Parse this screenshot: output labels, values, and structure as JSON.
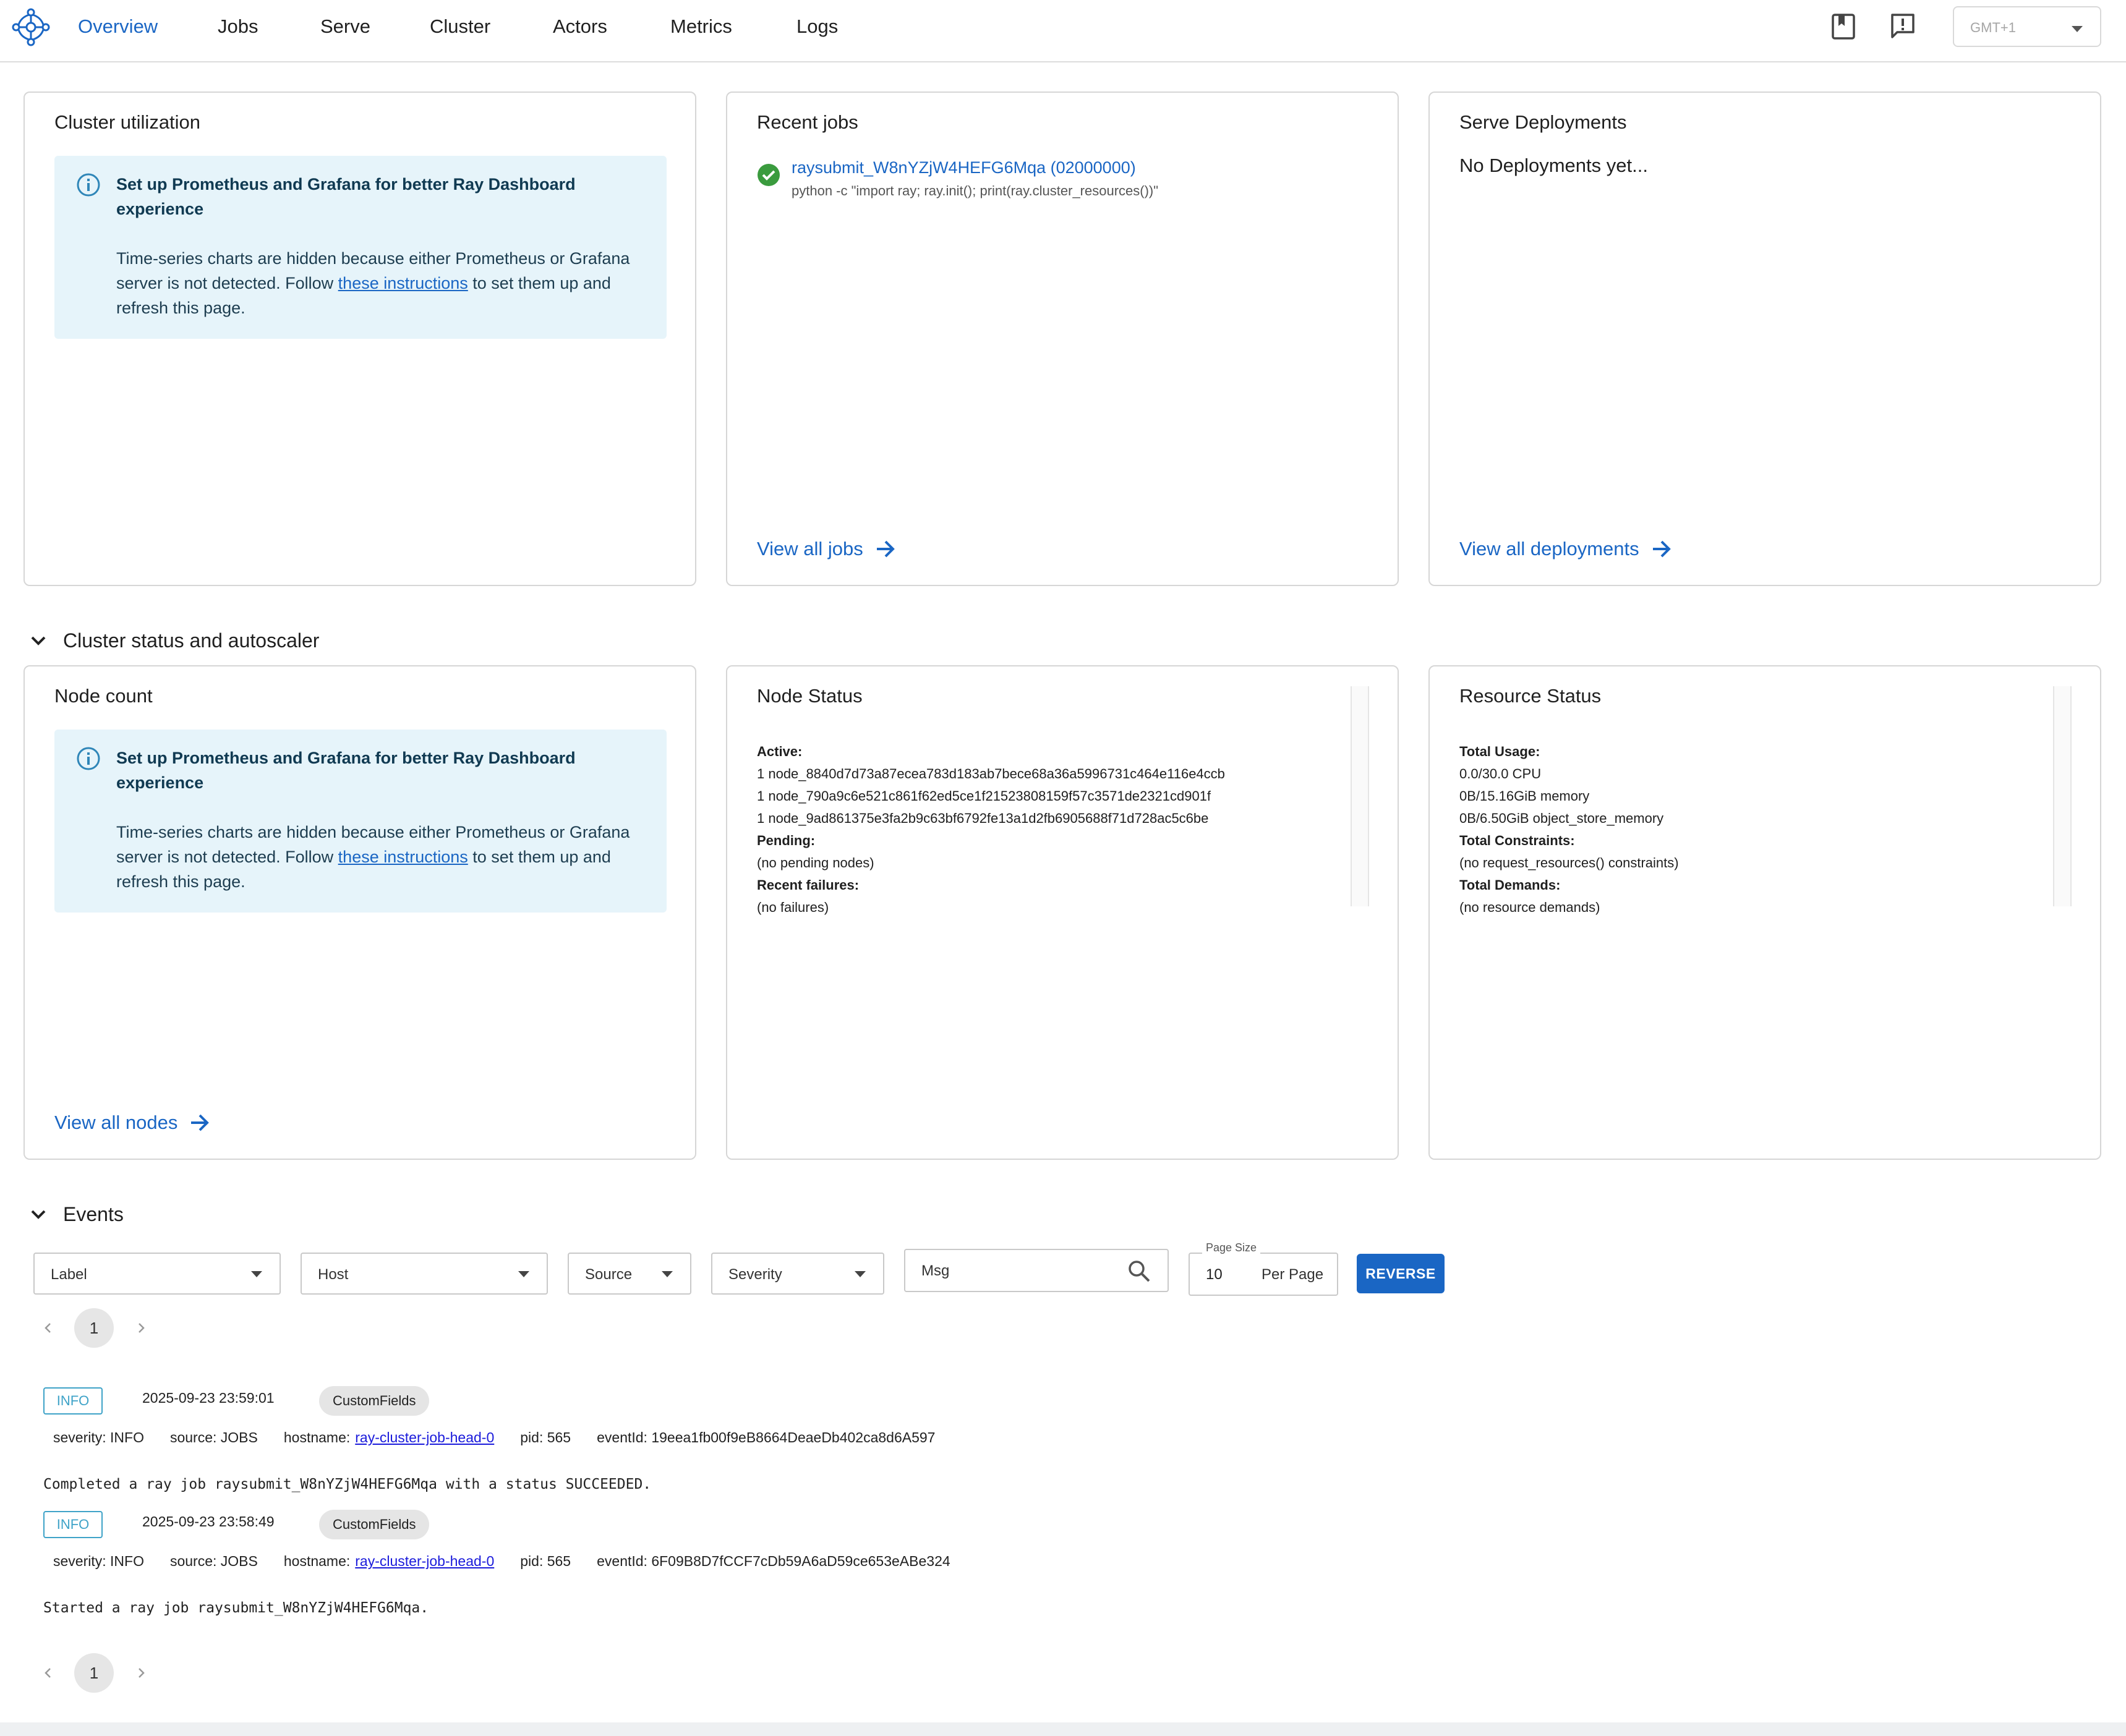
{
  "nav": {
    "tabs": [
      {
        "label": "Overview",
        "active": true
      },
      {
        "label": "Jobs"
      },
      {
        "label": "Serve"
      },
      {
        "label": "Cluster"
      },
      {
        "label": "Actors"
      },
      {
        "label": "Metrics"
      },
      {
        "label": "Logs"
      }
    ],
    "timezone": "GMT+1",
    "icons": [
      "ray-logo-icon",
      "docs-book-icon",
      "feedback-icon"
    ]
  },
  "cards": {
    "cluster_utilization": {
      "title": "Cluster utilization",
      "alert": {
        "title": "Set up Prometheus and Grafana for better Ray Dashboard experience",
        "body_before": "Time-series charts are hidden because either Prometheus or Grafana server is not detected. Follow ",
        "link": "these instructions",
        "body_after": " to set them up and refresh this page."
      }
    },
    "recent_jobs": {
      "title": "Recent jobs",
      "job_name": "raysubmit_W8nYZjW4HEFG6Mqa (02000000)",
      "job_command": "python -c \"import ray; ray.init(); print(ray.cluster_resources())\"",
      "view_all": "View all jobs"
    },
    "serve_deployments": {
      "title": "Serve Deployments",
      "empty": "No Deployments yet...",
      "view_all": "View all deployments"
    },
    "node_count": {
      "title": "Node count",
      "alert": {
        "title": "Set up Prometheus and Grafana for better Ray Dashboard experience",
        "body_before": "Time-series charts are hidden because either Prometheus or Grafana server is not detected. Follow ",
        "link": "these instructions",
        "body_after": " to set them up and refresh this page."
      },
      "view_all": "View all nodes"
    },
    "node_status": {
      "title": "Node Status",
      "lines": [
        {
          "text": "Active:",
          "bold": true
        },
        {
          "text": "1 node_8840d7d73a87ecea783d183ab7bece68a36a5996731c464e116e4ccb"
        },
        {
          "text": "1 node_790a9c6e521c861f62ed5ce1f21523808159f57c3571de2321cd901f"
        },
        {
          "text": "1 node_9ad861375e3fa2b9c63bf6792fe13a1d2fb6905688f71d728ac5c6be"
        },
        {
          "text": "Pending:",
          "bold": true
        },
        {
          "text": "(no pending nodes)"
        },
        {
          "text": "Recent failures:",
          "bold": true
        },
        {
          "text": "(no failures)"
        }
      ]
    },
    "resource_status": {
      "title": "Resource Status",
      "lines": [
        {
          "text": "Total Usage:",
          "bold": true
        },
        {
          "text": "0.0/30.0 CPU"
        },
        {
          "text": "0B/15.16GiB memory"
        },
        {
          "text": "0B/6.50GiB object_store_memory"
        },
        {
          "text": "Total Constraints:",
          "bold": true
        },
        {
          "text": "(no request_resources() constraints)"
        },
        {
          "text": "Total Demands:",
          "bold": true
        },
        {
          "text": "(no resource demands)"
        }
      ]
    }
  },
  "sections": {
    "cluster_status": "Cluster status and autoscaler",
    "events": "Events"
  },
  "filters": {
    "label": "Label",
    "host": "Host",
    "source": "Source",
    "severity": "Severity",
    "msg_placeholder": "Msg",
    "page_size_label": "Page Size",
    "page_size_value": "10",
    "per_page": "Per Page",
    "reverse": "REVERSE"
  },
  "pagination": {
    "current_page": "1"
  },
  "events": [
    {
      "level": "INFO",
      "time": "2025-09-23 23:59:01",
      "chip": "CustomFields",
      "severity": "severity: INFO",
      "source": "source: JOBS",
      "hostname_label": "hostname:",
      "hostname": "ray-cluster-job-head-0",
      "pid": "pid: 565",
      "event_id": "eventId: 19eea1fb00f9eB8664DeaeDb402ca8d6A597",
      "message": "Completed a ray job raysubmit_W8nYZjW4HEFG6Mqa with a status SUCCEEDED."
    },
    {
      "level": "INFO",
      "time": "2025-09-23 23:58:49",
      "chip": "CustomFields",
      "severity": "severity: INFO",
      "source": "source: JOBS",
      "hostname_label": "hostname:",
      "hostname": "ray-cluster-job-head-0",
      "pid": "pid: 565",
      "event_id": "eventId: 6F09B8D7fCCF7cDb59A6aD59ce653eABe324",
      "message": "Started a ray job raysubmit_W8nYZjW4HEFG6Mqa."
    }
  ],
  "colors": {
    "accent": "#1a66c4",
    "info_bg": "#e6f4fa",
    "success": "#3a9b3e",
    "info_badge": "#3fa3c8"
  }
}
